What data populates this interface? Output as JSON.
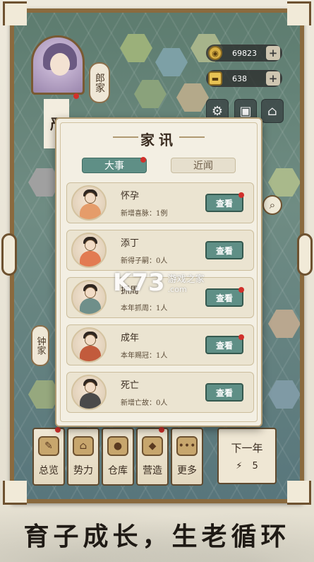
{
  "resources": {
    "gold": {
      "icon": "coin-icon",
      "value": "69823",
      "plus": "+"
    },
    "ingot": {
      "icon": "gold-ingot-icon",
      "value": "638",
      "plus": "+"
    }
  },
  "toolbar": {
    "settings_icon": "gear-icon",
    "save_icon": "save-icon",
    "home_icon": "location-pin-icon"
  },
  "player": {
    "left_name": "严",
    "clan_tag": "郎家"
  },
  "side": {
    "clan_tag_2": "钟家"
  },
  "modal": {
    "title": "家讯",
    "tabs": [
      {
        "label": "大事",
        "active": true
      },
      {
        "label": "近闻",
        "active": false
      }
    ],
    "events": [
      {
        "title": "怀孕",
        "subtitle": "新增喜脉：1例",
        "button": "查看",
        "has_dot": true,
        "body_color": "#e59c6a"
      },
      {
        "title": "添丁",
        "subtitle": "新得子嗣：0人",
        "button": "查看",
        "has_dot": false,
        "body_color": "#e27b52"
      },
      {
        "title": "抓周",
        "subtitle": "本年抓周：1人",
        "button": "查看",
        "has_dot": true,
        "body_color": "#6f8f8a"
      },
      {
        "title": "成年",
        "subtitle": "本年赐冠：1人",
        "button": "查看",
        "has_dot": true,
        "body_color": "#c25b3c"
      },
      {
        "title": "死亡",
        "subtitle": "新增亡故：0人",
        "button": "查看",
        "has_dot": false,
        "body_color": "#4a4a4a"
      }
    ]
  },
  "menu": {
    "items": [
      {
        "label": "总览",
        "icon": "scroll-brush-icon",
        "has_dot": true
      },
      {
        "label": "势力",
        "icon": "building-icon",
        "has_dot": false
      },
      {
        "label": "仓库",
        "icon": "sack-icon",
        "has_dot": false
      },
      {
        "label": "营造",
        "icon": "trowel-icon",
        "has_dot": true
      },
      {
        "label": "更多",
        "icon": "more-dots-icon",
        "has_dot": false
      }
    ],
    "next_year": {
      "label": "下一年",
      "count": "5",
      "icon": "lightning-icon"
    }
  },
  "watermark": {
    "logo": "K73",
    "cn": "游戏之家",
    "url": ".com"
  },
  "caption": "育子成长，生老循环"
}
